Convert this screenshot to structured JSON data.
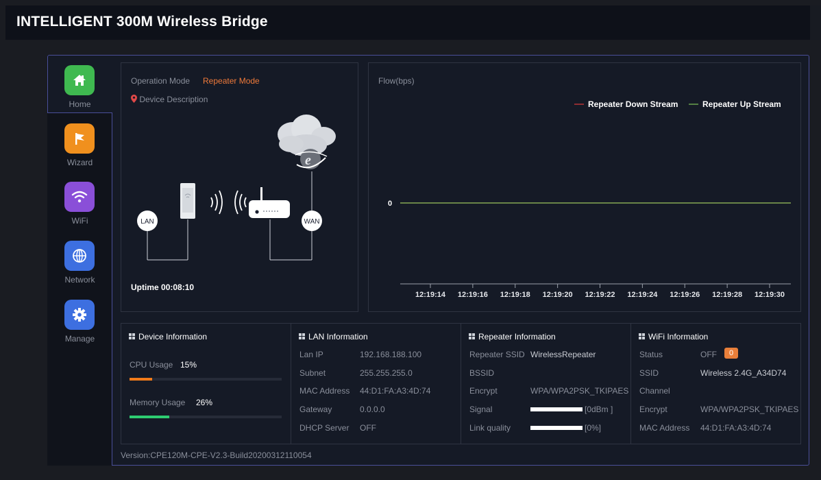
{
  "header": {
    "title": "INTELLIGENT 300M Wireless Bridge"
  },
  "nav": {
    "items": [
      {
        "label": "Home",
        "icon": "home-icon",
        "color": "#3fb950"
      },
      {
        "label": "Wizard",
        "icon": "flag-icon",
        "color": "#f0901e"
      },
      {
        "label": "WiFi",
        "icon": "wifi-icon",
        "color": "#8a4fd8"
      },
      {
        "label": "Network",
        "icon": "globe-icon",
        "color": "#3d6fe0"
      },
      {
        "label": "Manage",
        "icon": "gear-icon",
        "color": "#3d6fe0"
      }
    ]
  },
  "mode": {
    "label": "Operation Mode",
    "value": "Repeater Mode",
    "description_label": "Device Description",
    "diagram": {
      "lan": "LAN",
      "wan": "WAN"
    },
    "uptime_label": "Uptime",
    "uptime_value": "00:08:10"
  },
  "flow": {
    "title": "Flow(bps)",
    "legend_down": "Repeater Down Stream",
    "legend_up": "Repeater Up Stream",
    "y_label": "0"
  },
  "chart_data": {
    "type": "line",
    "title": "Flow(bps)",
    "x": [
      "12:19:14",
      "12:19:16",
      "12:19:18",
      "12:19:20",
      "12:19:22",
      "12:19:24",
      "12:19:26",
      "12:19:28",
      "12:19:30"
    ],
    "series": [
      {
        "name": "Repeater Down Stream",
        "color": "#e03b3b",
        "values": [
          0,
          0,
          0,
          0,
          0,
          0,
          0,
          0,
          0
        ]
      },
      {
        "name": "Repeater Up Stream",
        "color": "#7fc45a",
        "values": [
          0,
          0,
          0,
          0,
          0,
          0,
          0,
          0,
          0
        ]
      }
    ],
    "y_ticks": [
      "0"
    ],
    "legend": "top-right"
  },
  "device_info": {
    "title": "Device Information",
    "cpu_label": "CPU Usage",
    "cpu_value": "15%",
    "cpu_fraction": 0.15,
    "cpu_color": "#f07a1a",
    "mem_label": "Memory Usage",
    "mem_value": "26%",
    "mem_fraction": 0.26,
    "mem_color": "#2ecc71"
  },
  "lan_info": {
    "title": "LAN Information",
    "rows": [
      {
        "label": "Lan IP",
        "value": "192.168.188.100"
      },
      {
        "label": "Subnet",
        "value": "255.255.255.0"
      },
      {
        "label": "MAC Address",
        "value": "44:D1:FA:A3:4D:74"
      },
      {
        "label": "Gateway",
        "value": "0.0.0.0"
      },
      {
        "label": "DHCP Server",
        "value": "OFF"
      }
    ]
  },
  "repeater_info": {
    "title": "Repeater Information",
    "ssid_label": "Repeater SSID",
    "ssid_value": "WirelessRepeater",
    "bssid_label": "BSSID",
    "bssid_value": "",
    "encrypt_label": "Encrypt",
    "encrypt_value": "WPA/WPA2PSK_TKIPAES",
    "signal_label": "Signal",
    "signal_value": "[0dBm ]",
    "link_label": "Link quality",
    "link_value": "[0%]"
  },
  "wifi_info": {
    "title": "WiFi Information",
    "status_label": "Status",
    "status_value": "OFF",
    "status_badge": "0",
    "ssid_label": "SSID",
    "ssid_value": "Wireless 2.4G_A34D74",
    "channel_label": "Channel",
    "channel_value": "",
    "encrypt_label": "Encrypt",
    "encrypt_value": "WPA/WPA2PSK_TKIPAES",
    "mac_label": "MAC Address",
    "mac_value": "44:D1:FA:A3:4D:74"
  },
  "footer": {
    "version": "Version:CPE120M-CPE-V2.3-Build20200312110054"
  }
}
